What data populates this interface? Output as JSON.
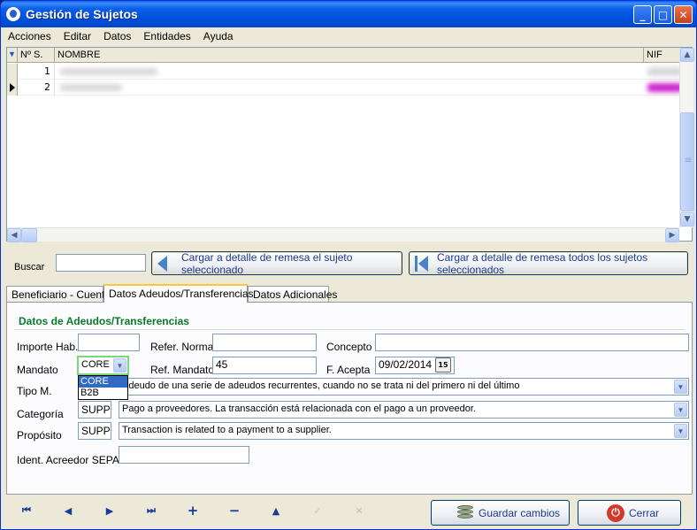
{
  "window": {
    "title": "Gestión de Sujetos"
  },
  "menu": [
    "Acciones",
    "Editar",
    "Datos",
    "Entidades",
    "Ayuda"
  ],
  "grid": {
    "columns": {
      "sel": "▼",
      "num": "Nº S.",
      "name": "NOMBRE",
      "nif": "NIF"
    },
    "rows": [
      {
        "num": "1"
      },
      {
        "num": "2"
      }
    ]
  },
  "search": {
    "label": "Buscar",
    "value": ""
  },
  "buttons": {
    "load_selected": "Cargar a detalle de remesa el sujeto seleccionado",
    "load_all": "Cargar a detalle de remesa todos los sujetos seleccionados",
    "save": "Guardar cambios",
    "close": "Cerrar"
  },
  "tabs": [
    "Beneficiario - Cuenta",
    "Datos Adeudos/Transferencias",
    "Datos Adicionales"
  ],
  "form": {
    "section_title": "Datos de Adeudos/Transferencias",
    "importe_label": "Importe Hab.",
    "importe_value": "",
    "refer_norma_label": "Refer. Norma",
    "refer_norma_value": "",
    "concepto_label": "Concepto",
    "concepto_value": "",
    "mandato_label": "Mandato",
    "mandato_value": "CORE",
    "mandato_options": [
      "CORE",
      "B2B"
    ],
    "ref_mandato_label": "Ref. Mandato",
    "ref_mandato_value": "45",
    "f_acepta_label": "F. Acepta",
    "f_acepta_value": "09/02/2014",
    "tipo_label": "Tipo M.",
    "tipo_desc": "Adeudo de una serie de adeudos recurrentes, cuando no se trata ni del primero ni del último",
    "categoria_label": "Categoría",
    "categoria_code": "SUPP",
    "categoria_desc": "Pago a proveedores. La transacción está relacionada con el pago a un proveedor.",
    "proposito_label": "Propósito",
    "proposito_code": "SUPP",
    "proposito_desc": "Transaction is related to a payment to a supplier.",
    "ident_label": "Ident. Acreedor SEPA",
    "ident_value": ""
  },
  "navigator": [
    "⏮",
    "◀",
    "▶",
    "⏭",
    "+",
    "−",
    "▲",
    "✓",
    "✕"
  ],
  "colors": {
    "title_bar": "#0a5fe8",
    "section_title": "#0a7a2a",
    "nif_highlight": "#cc22cc"
  }
}
